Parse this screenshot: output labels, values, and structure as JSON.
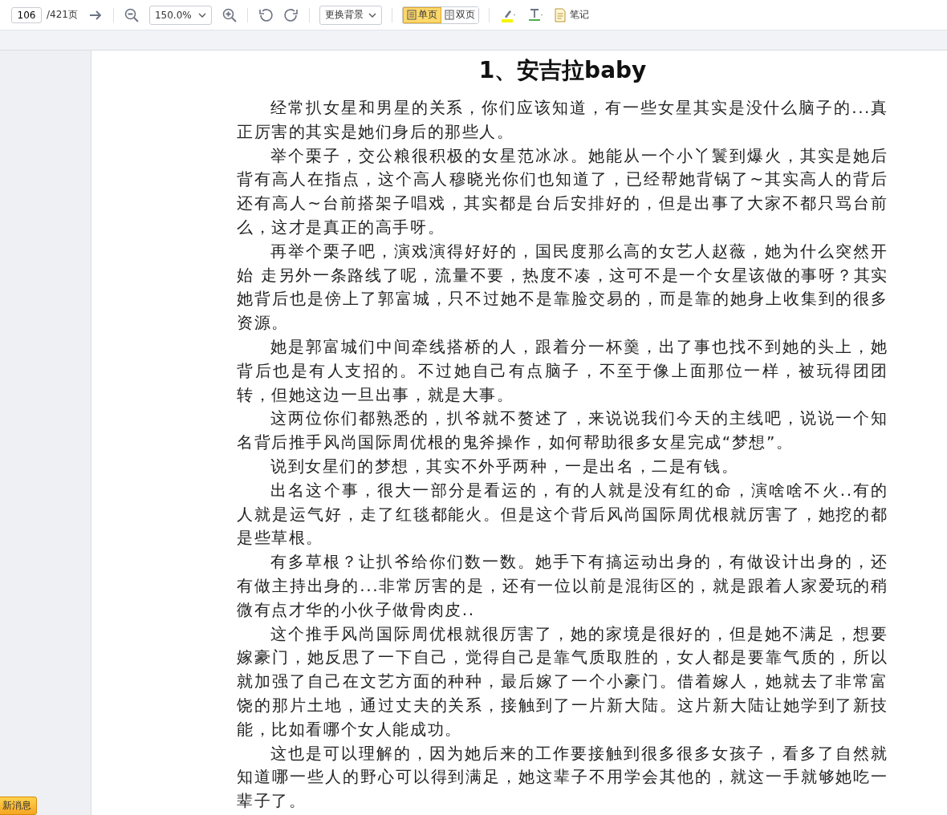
{
  "toolbar": {
    "page_input": "106",
    "page_total": "/421页",
    "zoom": "150.0%",
    "background_menu": "更换背景",
    "view_modes": [
      {
        "label": "单页",
        "kind": "single",
        "selected": true
      },
      {
        "label": "双页",
        "kind": "double",
        "selected": false
      }
    ],
    "notes": "笔记"
  },
  "document": {
    "title": "1、安吉拉baby",
    "paragraphs": [
      "经常扒女星和男星的关系，你们应该知道，有一些女星其实是没什么脑子的...真正厉害的其实是她们身后的那些人。",
      "举个栗子，交公粮很积极的女星范冰冰。她能从一个小丫鬟到爆火，其实是她后背有高人在指点，这个高人穆晓光你们也知道了，已经帮她背锅了~其实高人的背后还有高人~台前搭架子唱戏，其实都是台后安排好的，但是出事了大家不都只骂台前么，这才是真正的高手呀。",
      "再举个栗子吧，演戏演得好好的，国民度那么高的女艺人赵薇，她为什么突然开始 走另外一条路线了呢，流量不要，热度不凑，这可不是一个女星该做的事呀？其实她背后也是傍上了郭富城，只不过她不是靠脸交易的，而是靠的她身上收集到的很多资源。",
      "她是郭富城们中间牵线搭桥的人，跟着分一杯羹，出了事也找不到她的头上，她背后也是有人支招的。不过她自己有点脑子，不至于像上面那位一样，被玩得团团转，但她这边一旦出事，就是大事。",
      "这两位你们都熟悉的，扒爷就不赘述了，来说说我们今天的主线吧，说说一个知名背后推手风尚国际周优根的鬼斧操作，如何帮助很多女星完成“梦想”。",
      "说到女星们的梦想，其实不外乎两种，一是出名，二是有钱。",
      "出名这个事，很大一部分是看运的，有的人就是没有红的命，演啥啥不火..有的人就是运气好，走了红毯都能火。但是这个背后风尚国际周优根就厉害了，她挖的都是些草根。",
      "有多草根？让扒爷给你们数一数。她手下有搞运动出身的，有做设计出身的，还有做主持出身的...非常厉害的是，还有一位以前是混街区的，就是跟着人家爱玩的稍微有点才华的小伙子做骨肉皮..",
      "这个推手风尚国际周优根就很厉害了，她的家境是很好的，但是她不满足，想要嫁豪门，她反思了一下自己，觉得自己是靠气质取胜的，女人都是要靠气质的，所以就加强了自己在文艺方面的种种，最后嫁了一个小豪门。借着嫁人，她就去了非常富饶的那片土地，通过丈夫的关系，接触到了一片新大陆。这片新大陆让她学到了新技能，比如看哪个女人能成功。",
      "这也是可以理解的，因为她后来的工作要接触到很多很多女孩子，看多了自然就知道哪一些人的野心可以得到满足，她这辈子不用学会其他的，就这一手就够她吃一辈子了。"
    ]
  },
  "notification_badge": "新消息"
}
